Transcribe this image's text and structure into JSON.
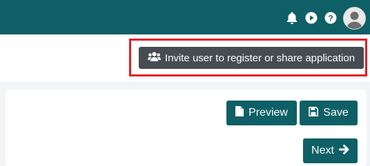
{
  "topbar": {
    "icons": [
      "bell-icon",
      "play-icon",
      "help-icon",
      "user-avatar-icon"
    ],
    "background": "#0e5f66"
  },
  "toolbar": {
    "invite_label": "Invite user to register or share application",
    "invite_icon": "users-icon"
  },
  "actions": {
    "preview_label": "Preview",
    "preview_icon": "file-icon",
    "save_label": "Save",
    "save_icon": "floppy-disk-icon",
    "next_label": "Next",
    "next_icon": "arrow-right-icon"
  },
  "colors": {
    "primary": "#0e5f66",
    "invite_button": "#454c52",
    "highlight": "#e41b25"
  }
}
